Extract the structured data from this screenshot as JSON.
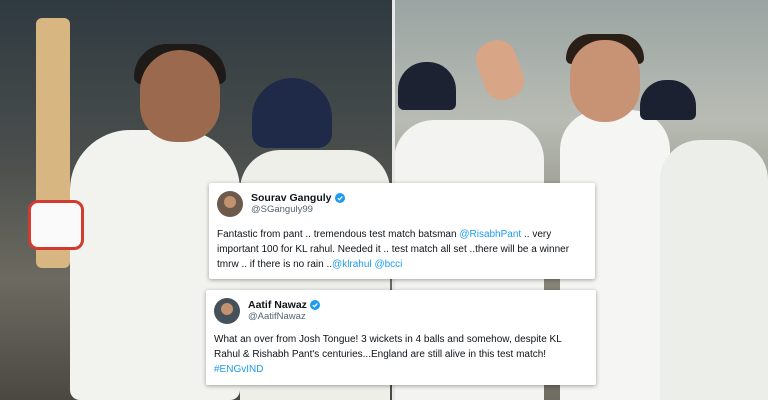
{
  "tweets": [
    {
      "name": "Sourav Ganguly",
      "handle": "@SGanguly99",
      "text_parts": [
        {
          "t": "Fantastic from pant .. tremendous test match batsman ",
          "link": false
        },
        {
          "t": "@RisabhPant",
          "link": true
        },
        {
          "t": " .. very important 100 for KL rahul. Needed it .. test match all set ..there will be a winner tmrw .. if there is no rain ..",
          "link": false
        },
        {
          "t": "@klrahul",
          "link": true
        },
        {
          "t": " ",
          "link": false
        },
        {
          "t": "@bcci",
          "link": true
        }
      ]
    },
    {
      "name": "Aatif Nawaz",
      "handle": "@AatifNawaz",
      "text_parts": [
        {
          "t": "What an over from Josh Tongue! 3 wickets in 4 balls and somehow, despite KL Rahul & Rishabh Pant's centuries...England are still alive in this test match! ",
          "link": false
        },
        {
          "t": "#ENGvIND",
          "link": true
        }
      ]
    }
  ],
  "colors": {
    "link": "#1d9bf0",
    "verified": "#1d9bf0",
    "text": "#0f1419",
    "muted": "#536471"
  },
  "icons": {
    "verified": "verified-badge-icon"
  }
}
